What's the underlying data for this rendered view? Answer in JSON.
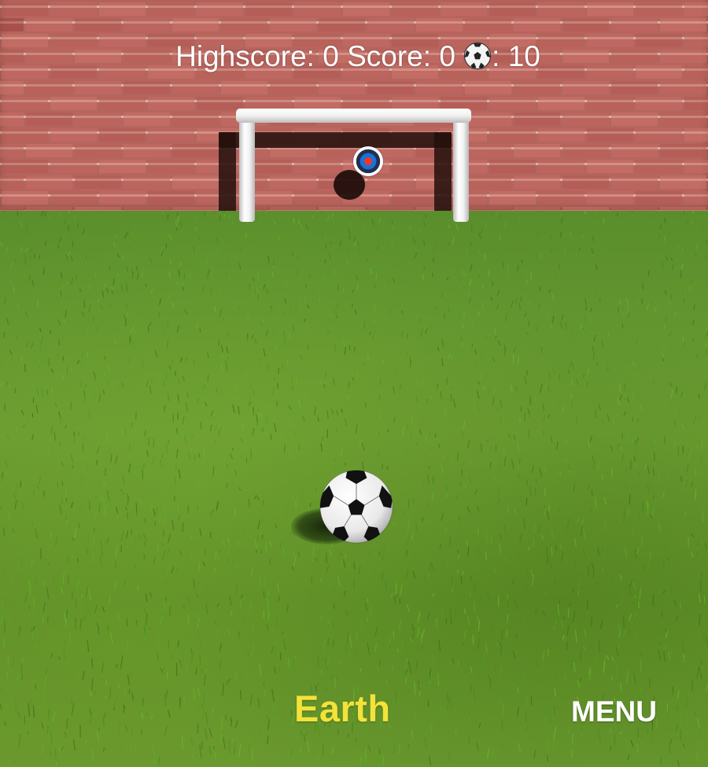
{
  "hud": {
    "highscore_label": "Highscore:",
    "highscore_value": "0",
    "score_label": "Score:",
    "score_value": "0",
    "balls_icon": "soccer-ball-icon",
    "balls_separator": ":",
    "balls_value": "10"
  },
  "world_label": "Earth",
  "menu_label": "MENU",
  "colors": {
    "world_label": "#f3e23a",
    "hud_text": "#ffffff",
    "brick": "#b5655d",
    "grass": "#5f9129"
  }
}
